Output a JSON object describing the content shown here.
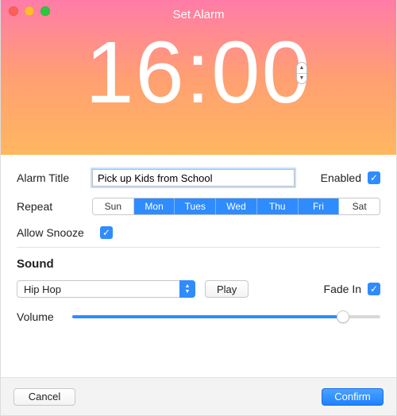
{
  "header": {
    "title": "Set Alarm",
    "time": "16:00"
  },
  "labels": {
    "alarm_title": "Alarm Title",
    "enabled": "Enabled",
    "repeat": "Repeat",
    "allow_snooze": "Allow Snooze",
    "sound": "Sound",
    "fade_in": "Fade In",
    "volume": "Volume"
  },
  "alarm": {
    "title_value": "Pick up Kids from School",
    "enabled": true,
    "allow_snooze": true
  },
  "repeat": {
    "days": [
      {
        "label": "Sun",
        "selected": false
      },
      {
        "label": "Mon",
        "selected": true
      },
      {
        "label": "Tues",
        "selected": true
      },
      {
        "label": "Wed",
        "selected": true
      },
      {
        "label": "Thu",
        "selected": true
      },
      {
        "label": "Fri",
        "selected": true
      },
      {
        "label": "Sat",
        "selected": false
      }
    ]
  },
  "sound": {
    "selected": "Hip Hop",
    "play_label": "Play",
    "fade_in": true,
    "volume_percent": 88
  },
  "footer": {
    "cancel": "Cancel",
    "confirm": "Confirm"
  },
  "colors": {
    "accent": "#2f8cff"
  }
}
